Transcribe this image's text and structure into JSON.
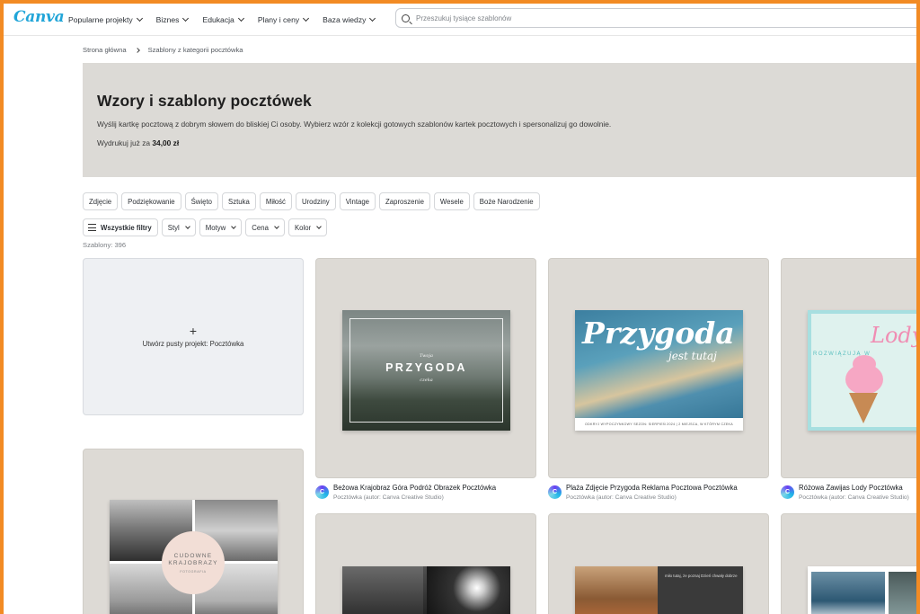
{
  "header": {
    "logo": "Canva",
    "nav": [
      {
        "label": "Popularne projekty"
      },
      {
        "label": "Biznes"
      },
      {
        "label": "Edukacja"
      },
      {
        "label": "Plany i ceny"
      },
      {
        "label": "Baza wiedzy"
      }
    ],
    "search_placeholder": "Przeszukuj tysiące szablonów"
  },
  "breadcrumb": {
    "home": "Strona główna",
    "current": "Szablony z kategorii pocztówka"
  },
  "hero": {
    "title": "Wzory i szablony pocztówek",
    "description": "Wyślij kartkę pocztową z dobrym słowem do bliskiej Ci osoby. Wybierz wzór z kolekcji gotowych szablonów kartek pocztowych i spersonalizuj go dowolnie.",
    "price_prefix": "Wydrukuj już za",
    "price_value": "34,00 zł"
  },
  "chips": [
    "Zdjęcie",
    "Podziękowanie",
    "Święto",
    "Sztuka",
    "Miłość",
    "Urodziny",
    "Vintage",
    "Zaproszenie",
    "Wesele",
    "Boże Narodzenie"
  ],
  "filters": {
    "all": "Wszystkie filtry",
    "items": [
      "Styl",
      "Motyw",
      "Cena",
      "Kolor"
    ]
  },
  "count": "Szablony: 396",
  "blank_card": {
    "plus": "+",
    "label": "Utwórz pusty projekt: Pocztówka"
  },
  "templates": [
    {
      "title": "Beżowa Krajobraz Góra Podróż Obrazek Pocztówka",
      "author": "Pocztówka (autor: Canva Creative Studio)",
      "thumb_small_top": "Twoja",
      "thumb_big": "PRZYGODA",
      "thumb_small_bottom": "czeka"
    },
    {
      "title": "Plaża Zdjęcie Przygoda Reklama Pocztowa Pocztówka",
      "author": "Pocztówka (autor: Canva Creative Studio)",
      "thumb_big": "Przygoda",
      "thumb_script": "jest tutaj",
      "thumb_strip": "ODKRYJ WYPOCZYNKOWY SEZON: SIERPIEŃ 2024 | 2 MIEJSCA, W KTÓRYM CZEKA"
    },
    {
      "title": "Różowa Zawijas Lody Pocztówka",
      "author": "Pocztówka (autor: Canva Creative Studio)",
      "thumb_big": "Lody",
      "thumb_sub": "ROZWIĄZUJĄ W"
    }
  ],
  "collage": {
    "line1": "CUDOWNE",
    "line2": "KRAJOBRAZY",
    "line3": "FOTOGRAFIA"
  },
  "row2": {
    "hat_text": "miło tutaj, że poznaj Dzień chwały dobrze"
  }
}
